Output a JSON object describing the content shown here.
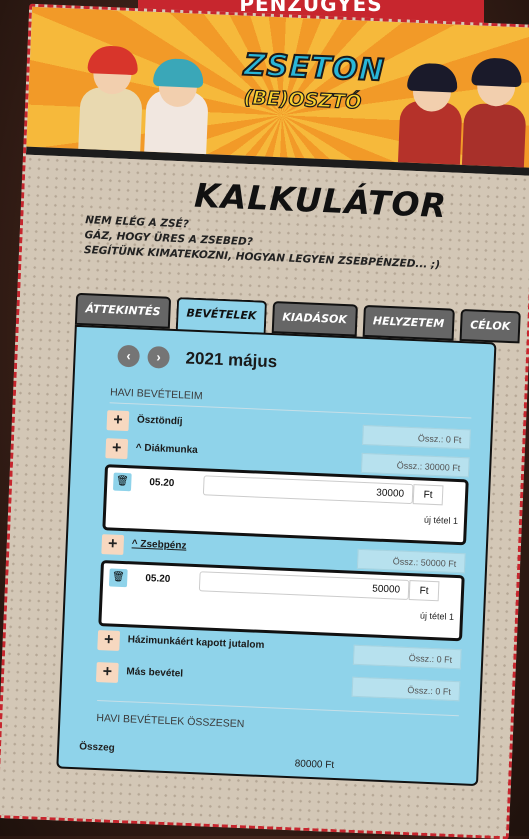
{
  "top_banner": {
    "label": "PÉNZÜGYES"
  },
  "header": {
    "logo_main": "ZSETON",
    "logo_sub": "(BE)OSZTÓ"
  },
  "page": {
    "title": "KALKULÁTOR",
    "intro_lines": [
      "NEM ELÉG A ZSÉ?",
      "GÁZ, HOGY ÜRES A ZSEBED?",
      "SEGÍTÜNK KIMATEKOZNI, HOGYAN LEGYEN ZSEBPÉNZED... ;)"
    ]
  },
  "tabs": [
    {
      "label": "ÁTTEKINTÉS",
      "active": false
    },
    {
      "label": "BEVÉTELEK",
      "active": true
    },
    {
      "label": "KIADÁSOK",
      "active": false
    },
    {
      "label": "HELYZETEM",
      "active": false
    },
    {
      "label": "CÉLOK",
      "active": false
    }
  ],
  "panel": {
    "nav": {
      "prev_icon": "chevron-left-icon",
      "next_icon": "chevron-right-icon",
      "month": "2021 május"
    },
    "section_title": "HAVI BEVÉTELEIM",
    "income_rows": [
      {
        "label": "Ösztöndíj",
        "sum": "Össz.: 0 Ft"
      },
      {
        "label": "^ Diákmunka",
        "sum": "Össz.: 30000 Ft"
      },
      {
        "label": "^ Zsebpénz",
        "sum": "Össz.: 50000 Ft"
      },
      {
        "label": "Házimunkáért kapott jutalom",
        "sum": "Össz.: 0 Ft"
      },
      {
        "label": "Más bevétel",
        "sum": "Össz.: 0 Ft"
      }
    ],
    "sub_entries": [
      {
        "date": "05.20",
        "amount": "30000",
        "currency": "Ft",
        "new_item": "új tétel 1"
      },
      {
        "date": "05.20",
        "amount": "50000",
        "currency": "Ft",
        "new_item": "új tétel 1"
      }
    ],
    "totals_title": "HAVI BEVÉTELEK ÖSSZESEN",
    "total_label": "Összeg",
    "total_value": "80000 Ft"
  },
  "colors": {
    "accent_red": "#c7262e",
    "panel_blue": "#8fd3ea",
    "plus_bg": "#f7d8c0"
  }
}
